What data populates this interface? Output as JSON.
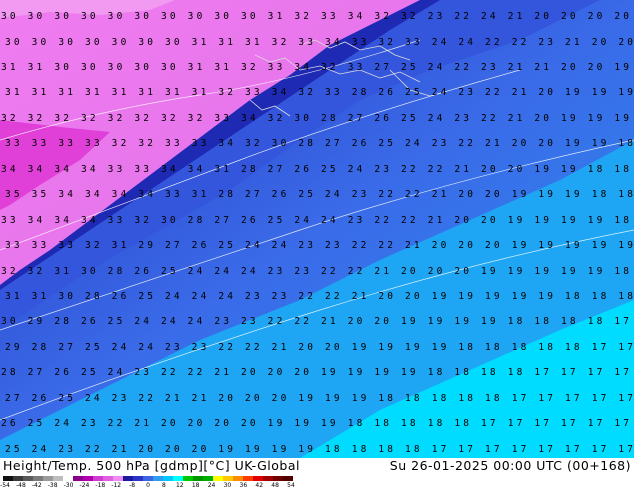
{
  "map": {
    "value_rows": [
      "30 30 30 30 30 30 30 30 30 30 31 32 33 34 32 32 23 22 24 21 20 20 20 20",
      "30 30 30 30 30 30 30 31 31 31 32 33 34 33 32 33 24 24 22 22 23 21 20 20",
      "31 31 30 30 30 30 30 31 31 32 33 34 32 33 27 25 24 22 23 21 21 20 20 19",
      "31 31 31 31 31 31 31 31 32 33 34 32 33 28 26 25 24 23 22 21 20 19 19 19",
      "32 32 32 32 32 32 32 32 33 34 32 30 28 27 26 25 24 23 22 21 20 19 19 19",
      "33 33 33 33 32 32 33 33 34 32 30 28 27 26 25 24 23 22 21 20 20 19 19 18",
      "34 34 34 34 33 33 34 34 31 28 27 26 25 24 23 22 22 21 20 20 19 19 18 18",
      "35 35 34 34 34 34 33 31 28 27 26 25 24 23 22 22 21 20 20 19 19 19 18 18",
      "33 34 34 34 33 32 30 28 27 26 25 24 24 23 22 22 21 20 20 19 19 19 19 18",
      "33 33 33 32 31 29 27 26 25 24 24 23 23 22 22 21 20 20 20 19 19 19 19 19",
      "32 32 31 30 28 26 25 24 24 24 23 23 22 22 21 20 20 20 19 19 19 19 19 18",
      "31 31 30 28 26 25 24 24 24 23 23 22 22 21 20 20 19 19 19 19 19 18 18 18",
      "30 29 28 26 25 24 24 24 23 23 22 22 21 20 20 19 19 19 19 18 18 18 18 17",
      "29 28 27 25 24 24 23 23 22 22 21 20 20 19 19 19 19 18 18 18 18 18 17 17",
      "28 27 26 25 24 23 22 22 21 20 20 20 19 19 19 19 18 18 18 18 17 17 17 17",
      "27 26 25 24 23 22 21 21 20 20 20 19 19 19 18 18 18 18 18 17 17 17 17 17",
      "26 25 24 23 22 21 20 20 20 20 19 19 19 18 18 18 18 18 17 17 17 17 17 17",
      "25 24 23 22 21 20 20 20 19 19 19 19 18 18 18 18 17 17 17 17 17 17 17 17"
    ]
  },
  "footer": {
    "title_left": "Height/Temp. 500 hPa [gdmp][°C] UK-Global",
    "title_right": "Su 26-01-2025 00:00 UTC (00+168)"
  },
  "scale": {
    "labels": [
      "-54",
      "-48",
      "-42",
      "-38",
      "-30",
      "-24",
      "-18",
      "-12",
      "-8",
      "0",
      "8",
      "12",
      "18",
      "24",
      "30",
      "36",
      "42",
      "48",
      "54"
    ],
    "colors": [
      "#111111",
      "#3a3a3a",
      "#5a5a5a",
      "#7a7a7a",
      "#9a9a9a",
      "#bdbdbd",
      "#ffffff",
      "#8b008b",
      "#b000b0",
      "#d13bd1",
      "#e060e0",
      "#f08cf0",
      "#1a1aa0",
      "#2a34c8",
      "#3a64e6",
      "#2f9cf0",
      "#00c8ff",
      "#00ffff",
      "#00c800",
      "#009600",
      "#00b000",
      "#ffff00",
      "#ffc800",
      "#ff8c00",
      "#ff3c00",
      "#e00000",
      "#a00000",
      "#700000",
      "#500000"
    ]
  }
}
